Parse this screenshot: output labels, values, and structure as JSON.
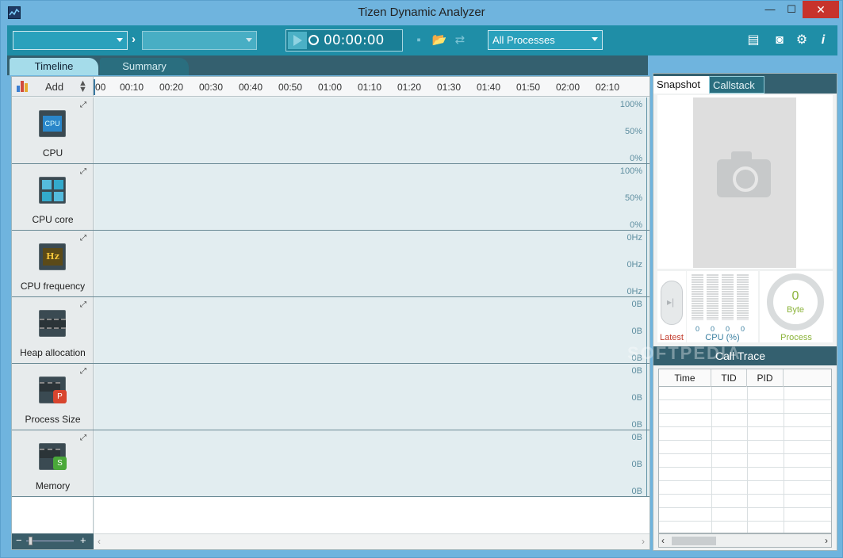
{
  "window": {
    "title": "Tizen Dynamic Analyzer",
    "min": "—",
    "max": "☐",
    "close": "✕"
  },
  "toolbar": {
    "device_value": "",
    "app_value": "",
    "timer": "00:00:00",
    "process_filter": "All Processes"
  },
  "tabs": {
    "timeline": "Timeline",
    "summary": "Summary"
  },
  "timeline": {
    "add_label": "Add",
    "ticks": [
      "00",
      "00:10",
      "00:20",
      "00:30",
      "00:40",
      "00:50",
      "01:00",
      "01:10",
      "01:20",
      "01:30",
      "01:40",
      "01:50",
      "02:00",
      "02:10"
    ],
    "rows": [
      {
        "name": "CPU",
        "icon": "cpu-icon",
        "y_top": "100%",
        "y_mid": "50%",
        "y_bot": "0%"
      },
      {
        "name": "CPU core",
        "icon": "cpu-core-icon",
        "y_top": "100%",
        "y_mid": "50%",
        "y_bot": "0%"
      },
      {
        "name": "CPU frequency",
        "icon": "cpu-frequency-icon",
        "y_top": "0Hz",
        "y_mid": "0Hz",
        "y_bot": "0Hz"
      },
      {
        "name": "Heap allocation",
        "icon": "heap-allocation-icon",
        "y_top": "0B",
        "y_mid": "0B",
        "y_bot": "0B"
      },
      {
        "name": "Process Size",
        "icon": "process-size-icon",
        "y_top": "0B",
        "y_mid": "0B",
        "y_bot": "0B"
      },
      {
        "name": "Memory",
        "icon": "memory-icon",
        "y_top": "0B",
        "y_mid": "0B",
        "y_bot": "0B"
      }
    ]
  },
  "right_panel": {
    "tabs": {
      "snapshot": "Snapshot",
      "callstack": "Callstack"
    },
    "latest_label": "Latest",
    "cpu_label": "CPU (%)",
    "cpu_values": [
      "0",
      "0",
      "0",
      "0"
    ],
    "process_label": "Process",
    "process_value": "0",
    "process_unit": "Byte",
    "call_trace": {
      "title": "Call Trace",
      "columns": [
        "Time",
        "TID",
        "PID"
      ]
    }
  },
  "watermark": "SOFTPEDIA",
  "colors": {
    "toolbar": "#1f8ea7",
    "tab_active": "#a5dcea",
    "panel_header": "#34606f"
  }
}
